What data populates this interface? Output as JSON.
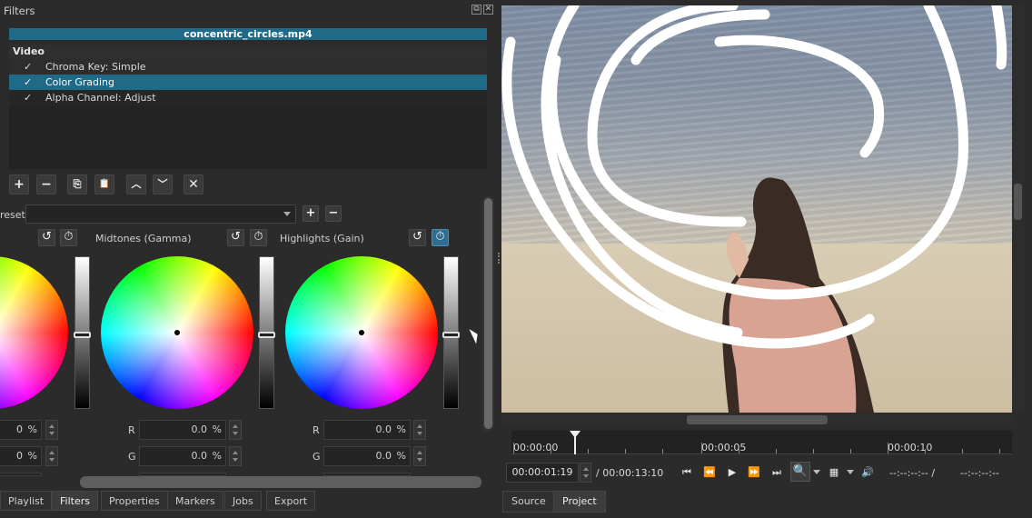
{
  "dock": {
    "title": "Filters",
    "float_icon": "float-icon",
    "close_icon": "close-icon"
  },
  "file": {
    "name": "concentric_circles.mp4"
  },
  "filter_list": {
    "header": "Video",
    "items": [
      {
        "check": "✓",
        "name": "Chroma Key: Simple",
        "selected": false
      },
      {
        "check": "✓",
        "name": "Color Grading",
        "selected": true
      },
      {
        "check": "✓",
        "name": "Alpha Channel: Adjust",
        "selected": false
      }
    ]
  },
  "toolbar": {
    "add": "+",
    "remove": "−",
    "copy": "⎘",
    "paste": "📋",
    "up": "︿",
    "down": "﹀",
    "deselect": "✕"
  },
  "preset": {
    "label": "reset",
    "value": "",
    "add": "+",
    "remove": "−"
  },
  "wheels": {
    "midtones_title": "Midtones (Gamma)",
    "highlights_title": "Highlights (Gain)",
    "reset_icon": "↺",
    "keyframe_icon": "⏱"
  },
  "rgb": {
    "left": {
      "r_value": "0",
      "g_value": "0",
      "unit": "%"
    },
    "mid": {
      "r_label": "R",
      "g_label": "G",
      "r_value": "0.0",
      "g_value": "0.0",
      "unit": "%"
    },
    "right": {
      "r_label": "R",
      "g_label": "G",
      "r_value": "0.0",
      "g_value": "0.0",
      "unit": "%"
    }
  },
  "left_tabs": [
    "Playlist",
    "Filters",
    "Properties",
    "Markers",
    "Jobs",
    "Export"
  ],
  "timeline": {
    "labels": [
      "00:00:00",
      "00:00:05",
      "00:00:10"
    ],
    "current": "00:00:01:19",
    "total": "/ 00:00:13:10",
    "in_point": "--:--:--:-- /",
    "out_point": "--:--:--:--"
  },
  "transport": {
    "skip_start": "⏮",
    "rewind": "⏪",
    "play": "▶",
    "forward": "⏩",
    "skip_end": "⏭",
    "zoom": "🔍",
    "grid": "▦",
    "volume": "🔊"
  },
  "viewer_tabs": [
    "Source",
    "Project"
  ],
  "colors": {
    "selection": "#1e6a87",
    "panel": "#2b2b2b",
    "active_button": "#2d6e91"
  }
}
